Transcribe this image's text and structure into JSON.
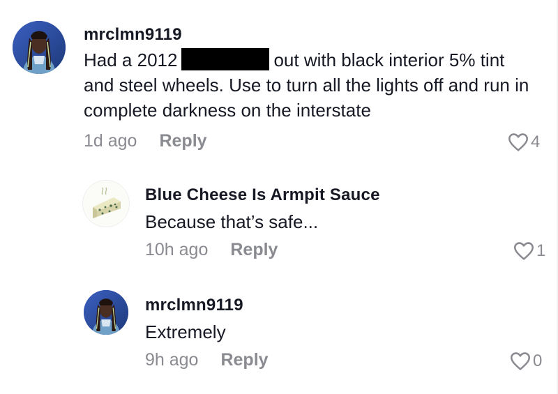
{
  "comments": [
    {
      "username": "mrclmn9119",
      "text_before": "Had a 2012",
      "text_after": "out with black interior 5% tint and steel wheels. Use to turn all the lights off and run in complete darkness on the interstate",
      "time": "1d ago",
      "reply_label": "Reply",
      "likes": "4",
      "avatar_icon": "person-avatar"
    },
    {
      "username": "Blue Cheese Is Armpit Sauce",
      "text": "Because that’s safe...",
      "time": "10h ago",
      "reply_label": "Reply",
      "likes": "1",
      "avatar_icon": "blue-cheese-avatar"
    },
    {
      "username": "mrclmn9119",
      "text": "Extremely",
      "time": "9h ago",
      "reply_label": "Reply",
      "likes": "0",
      "avatar_icon": "person-avatar"
    }
  ],
  "colors": {
    "text": "#161823",
    "muted": "#8a8b91"
  }
}
